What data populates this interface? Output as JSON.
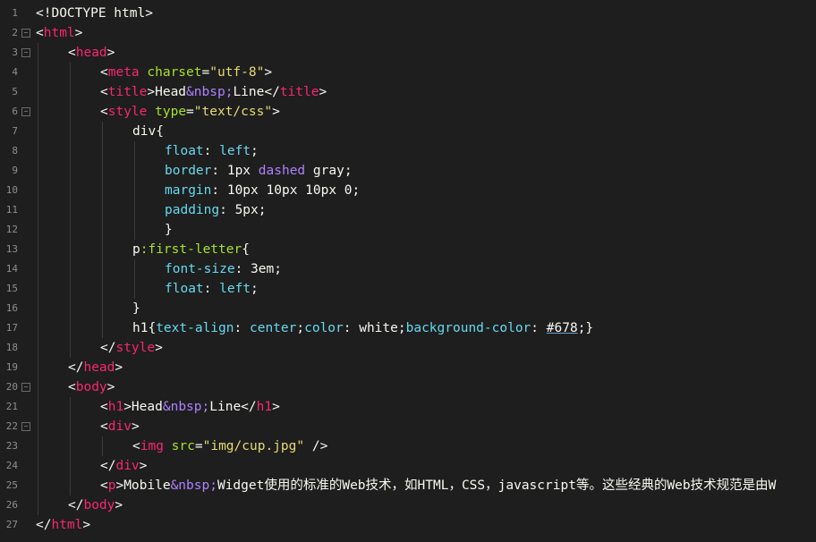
{
  "editor": {
    "lines": [
      {
        "n": "1",
        "fold": "",
        "indent": 0,
        "tokens": [
          {
            "t": "<!DOCTYPE html>",
            "c": "plain"
          }
        ]
      },
      {
        "n": "2",
        "fold": "⊟",
        "indent": 0,
        "tokens": [
          {
            "t": "<",
            "c": "plain"
          },
          {
            "t": "html",
            "c": "tag"
          },
          {
            "t": ">",
            "c": "plain"
          }
        ]
      },
      {
        "n": "3",
        "fold": "⊟",
        "indent": 1,
        "tokens": [
          {
            "t": "<",
            "c": "plain"
          },
          {
            "t": "head",
            "c": "tag"
          },
          {
            "t": ">",
            "c": "plain"
          }
        ]
      },
      {
        "n": "4",
        "fold": "",
        "indent": 2,
        "tokens": [
          {
            "t": "<",
            "c": "plain"
          },
          {
            "t": "meta",
            "c": "tag"
          },
          {
            "t": " ",
            "c": "plain"
          },
          {
            "t": "charset",
            "c": "attr"
          },
          {
            "t": "=",
            "c": "plain"
          },
          {
            "t": "\"utf-8\"",
            "c": "string"
          },
          {
            "t": ">",
            "c": "plain"
          }
        ]
      },
      {
        "n": "5",
        "fold": "",
        "indent": 2,
        "tokens": [
          {
            "t": "<",
            "c": "plain"
          },
          {
            "t": "title",
            "c": "tag"
          },
          {
            "t": ">Head",
            "c": "plain"
          },
          {
            "t": "&nbsp;",
            "c": "ent"
          },
          {
            "t": "Line</",
            "c": "plain"
          },
          {
            "t": "title",
            "c": "tag"
          },
          {
            "t": ">",
            "c": "plain"
          }
        ]
      },
      {
        "n": "6",
        "fold": "⊟",
        "indent": 2,
        "tokens": [
          {
            "t": "<",
            "c": "plain"
          },
          {
            "t": "style",
            "c": "tag"
          },
          {
            "t": " ",
            "c": "plain"
          },
          {
            "t": "type",
            "c": "attr"
          },
          {
            "t": "=",
            "c": "plain"
          },
          {
            "t": "\"text/css\"",
            "c": "string"
          },
          {
            "t": ">",
            "c": "plain"
          }
        ]
      },
      {
        "n": "7",
        "fold": "",
        "indent": 3,
        "tokens": [
          {
            "t": "div{",
            "c": "plain"
          }
        ]
      },
      {
        "n": "8",
        "fold": "",
        "indent": 4,
        "tokens": [
          {
            "t": "float",
            "c": "prop"
          },
          {
            "t": ": ",
            "c": "plain"
          },
          {
            "t": "left",
            "c": "val"
          },
          {
            "t": ";",
            "c": "plain"
          }
        ]
      },
      {
        "n": "9",
        "fold": "",
        "indent": 4,
        "tokens": [
          {
            "t": "border",
            "c": "prop"
          },
          {
            "t": ": 1px ",
            "c": "plain"
          },
          {
            "t": "dashed",
            "c": "kw"
          },
          {
            "t": " gray;",
            "c": "plain"
          }
        ]
      },
      {
        "n": "10",
        "fold": "",
        "indent": 4,
        "tokens": [
          {
            "t": "margin",
            "c": "prop"
          },
          {
            "t": ": 10px 10px 10px 0;",
            "c": "plain"
          }
        ]
      },
      {
        "n": "11",
        "fold": "",
        "indent": 4,
        "tokens": [
          {
            "t": "padding",
            "c": "prop"
          },
          {
            "t": ": 5px;",
            "c": "plain"
          }
        ]
      },
      {
        "n": "12",
        "fold": "",
        "indent": 4,
        "tokens": [
          {
            "t": "}",
            "c": "plain"
          }
        ]
      },
      {
        "n": "13",
        "fold": "",
        "indent": 3,
        "tokens": [
          {
            "t": "p",
            "c": "plain"
          },
          {
            "t": ":first-letter",
            "c": "pseudo"
          },
          {
            "t": "{",
            "c": "plain"
          }
        ]
      },
      {
        "n": "14",
        "fold": "",
        "indent": 4,
        "tokens": [
          {
            "t": "font-size",
            "c": "prop"
          },
          {
            "t": ": 3em;",
            "c": "plain"
          }
        ]
      },
      {
        "n": "15",
        "fold": "",
        "indent": 4,
        "tokens": [
          {
            "t": "float",
            "c": "prop"
          },
          {
            "t": ": ",
            "c": "plain"
          },
          {
            "t": "left",
            "c": "val"
          },
          {
            "t": ";",
            "c": "plain"
          }
        ]
      },
      {
        "n": "16",
        "fold": "",
        "indent": 3,
        "tokens": [
          {
            "t": "}",
            "c": "plain"
          }
        ]
      },
      {
        "n": "17",
        "fold": "",
        "indent": 3,
        "tokens": [
          {
            "t": "h1{",
            "c": "plain"
          },
          {
            "t": "text-align",
            "c": "prop"
          },
          {
            "t": ": ",
            "c": "plain"
          },
          {
            "t": "center",
            "c": "val"
          },
          {
            "t": ";",
            "c": "plain"
          },
          {
            "t": "color",
            "c": "prop"
          },
          {
            "t": ": white;",
            "c": "plain"
          },
          {
            "t": "background-color",
            "c": "prop"
          },
          {
            "t": ": ",
            "c": "plain"
          },
          {
            "t": "#678",
            "c": "color"
          },
          {
            "t": ";}",
            "c": "plain"
          }
        ]
      },
      {
        "n": "18",
        "fold": "",
        "indent": 2,
        "tokens": [
          {
            "t": "</",
            "c": "plain"
          },
          {
            "t": "style",
            "c": "tag"
          },
          {
            "t": ">",
            "c": "plain"
          }
        ]
      },
      {
        "n": "19",
        "fold": "",
        "indent": 1,
        "tokens": [
          {
            "t": "</",
            "c": "plain"
          },
          {
            "t": "head",
            "c": "tag"
          },
          {
            "t": ">",
            "c": "plain"
          }
        ]
      },
      {
        "n": "20",
        "fold": "⊟",
        "indent": 1,
        "tokens": [
          {
            "t": "<",
            "c": "plain"
          },
          {
            "t": "body",
            "c": "tag"
          },
          {
            "t": ">",
            "c": "plain"
          }
        ]
      },
      {
        "n": "21",
        "fold": "",
        "indent": 2,
        "tokens": [
          {
            "t": "<",
            "c": "plain"
          },
          {
            "t": "h1",
            "c": "tag"
          },
          {
            "t": ">Head",
            "c": "plain"
          },
          {
            "t": "&nbsp;",
            "c": "ent"
          },
          {
            "t": "Line</",
            "c": "plain"
          },
          {
            "t": "h1",
            "c": "tag"
          },
          {
            "t": ">",
            "c": "plain"
          }
        ]
      },
      {
        "n": "22",
        "fold": "⊟",
        "indent": 2,
        "tokens": [
          {
            "t": "<",
            "c": "plain"
          },
          {
            "t": "div",
            "c": "tag"
          },
          {
            "t": ">",
            "c": "plain"
          }
        ]
      },
      {
        "n": "23",
        "fold": "",
        "indent": 3,
        "tokens": [
          {
            "t": "<",
            "c": "plain"
          },
          {
            "t": "img",
            "c": "tag"
          },
          {
            "t": " ",
            "c": "plain"
          },
          {
            "t": "src",
            "c": "attr"
          },
          {
            "t": "=",
            "c": "plain"
          },
          {
            "t": "\"img/cup.jpg\"",
            "c": "string"
          },
          {
            "t": " />",
            "c": "plain"
          }
        ]
      },
      {
        "n": "24",
        "fold": "",
        "indent": 2,
        "tokens": [
          {
            "t": "</",
            "c": "plain"
          },
          {
            "t": "div",
            "c": "tag"
          },
          {
            "t": ">",
            "c": "plain"
          }
        ]
      },
      {
        "n": "25",
        "fold": "",
        "indent": 2,
        "tokens": [
          {
            "t": "<",
            "c": "plain"
          },
          {
            "t": "p",
            "c": "tag"
          },
          {
            "t": ">Mobile",
            "c": "plain"
          },
          {
            "t": "&nbsp;",
            "c": "ent"
          },
          {
            "t": "Widget使用的标准的Web技术，如HTML，CSS，javascript等。这些经典的Web技术规范是由W",
            "c": "plain"
          }
        ]
      },
      {
        "n": "26",
        "fold": "",
        "indent": 1,
        "tokens": [
          {
            "t": "</",
            "c": "plain"
          },
          {
            "t": "body",
            "c": "tag"
          },
          {
            "t": ">",
            "c": "plain"
          }
        ]
      },
      {
        "n": "27",
        "fold": "",
        "indent": 0,
        "tokens": [
          {
            "t": "</",
            "c": "plain"
          },
          {
            "t": "html",
            "c": "tag"
          },
          {
            "t": ">",
            "c": "plain"
          }
        ]
      }
    ]
  }
}
